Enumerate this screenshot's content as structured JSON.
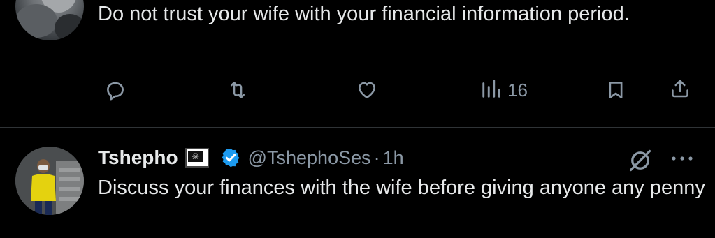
{
  "tweet1": {
    "text": "Do not trust your wife with your financial information period.",
    "actions": {
      "reply_icon": "reply-icon",
      "retweet_icon": "retweet-icon",
      "like_icon": "heart-icon",
      "views_icon": "views-icon",
      "views_count": "16",
      "bookmark_icon": "bookmark-icon",
      "share_icon": "share-icon"
    }
  },
  "tweet2": {
    "author_name": "Tshepho",
    "flag_emoji": "🏴‍☠️",
    "handle": "@TshephoSes",
    "separator": "·",
    "time": "1h",
    "text": "Discuss your finances with the wife before giving anyone any penny",
    "more_icon": "more-icon",
    "grok_icon": "grok-icon"
  },
  "colors": {
    "background": "#000000",
    "text": "#e7e9ea",
    "secondary": "#8b98a5",
    "verified": "#1d9bf0",
    "divider": "#2f3336"
  }
}
